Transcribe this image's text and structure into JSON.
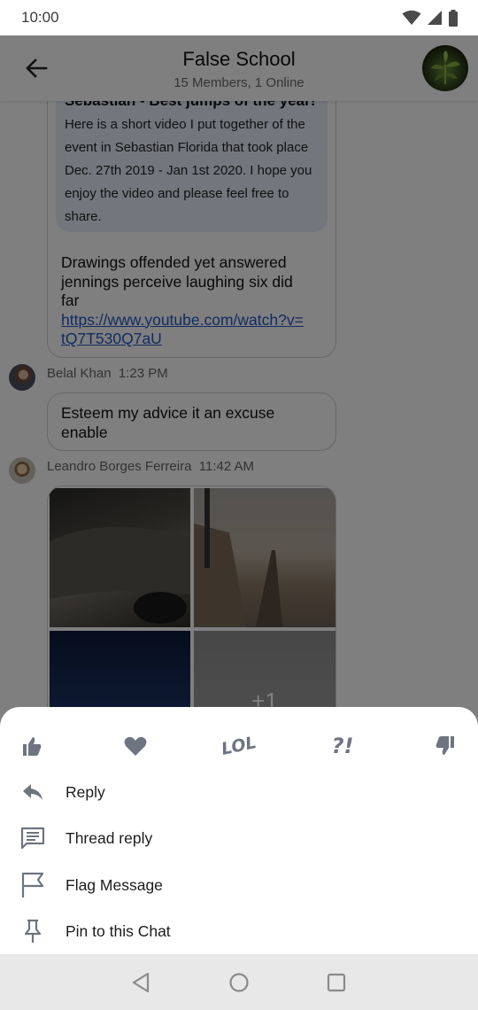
{
  "status_bar": {
    "time": "10:00"
  },
  "header": {
    "title": "False School",
    "subtitle": "15 Members, 1 Online"
  },
  "messages": {
    "quote": {
      "title": "Sebastian - Best jumps of the year!",
      "body_lines": [
        "Here is a short video I put together of the",
        "event in Sebastian Florida that took place",
        "Dec. 27th 2019 - Jan 1st 2020. I hope you",
        "enjoy the video and please feel free to",
        "share."
      ]
    },
    "first_text_lines": [
      "Drawings offended yet answered",
      "jennings perceive laughing six did",
      "far"
    ],
    "first_link_lines": [
      "https://www.youtube.com/watch?v=",
      "tQ7T530Q7aU"
    ],
    "belal": {
      "name": "Belal Khan",
      "time": "1:23 PM",
      "text_lines": [
        "Esteem my advice it an excuse",
        "enable"
      ]
    },
    "leandro": {
      "name": "Leandro Borges Ferreira",
      "time": "11:42 AM",
      "more_count": "+1"
    }
  },
  "reactions": [
    {
      "icon": "thumbs-up-icon"
    },
    {
      "icon": "heart-icon"
    },
    {
      "icon": "lol-icon",
      "text": "LOL"
    },
    {
      "icon": "question-exclaim-icon",
      "text": "?!"
    },
    {
      "icon": "thumbs-down-icon"
    }
  ],
  "menu": [
    {
      "icon": "reply-icon",
      "label": "Reply"
    },
    {
      "icon": "thread-reply-icon",
      "label": "Thread reply"
    },
    {
      "icon": "flag-icon",
      "label": "Flag Message"
    },
    {
      "icon": "pin-icon",
      "label": "Pin to this Chat"
    }
  ],
  "colors": {
    "accent_icon": "#7a7f8c",
    "link": "#2457c5",
    "quote_bg": "#e6ecfb"
  }
}
